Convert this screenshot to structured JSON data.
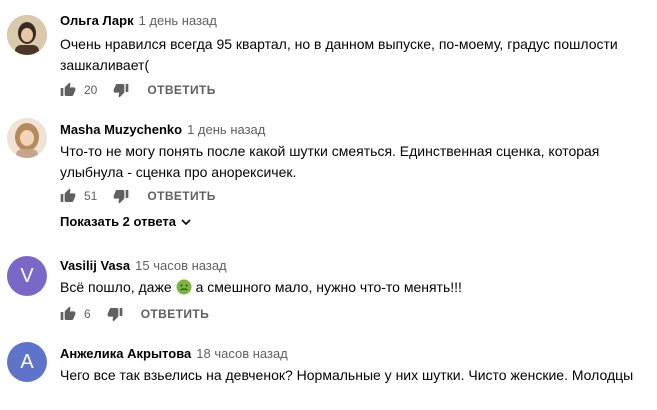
{
  "comments": [
    {
      "author": "Ольга Ларк",
      "time": "1 день назад",
      "text": "Очень нравился всегда 95 квартал, но в данном выпуске, по-моему, градус пошлости зашкаливает(",
      "likes": "20",
      "reply_label": "ОТВЕТИТЬ"
    },
    {
      "author": "Masha Muzychenko",
      "time": "1 день назад",
      "text": "Что-то не могу понять после какой шутки смеяться. Единственная сценка, которая улыбнула - сценка про анорексичек.",
      "likes": "51",
      "reply_label": "ОТВЕТИТЬ",
      "show_replies": "Показать 2 ответа"
    },
    {
      "author": "Vasilij Vasa",
      "time": "15 часов назад",
      "avatar_letter": "V",
      "text_before": "Всё пошло, даже",
      "text_after": "а смешного мало, нужно что-то менять!!!",
      "likes": "6",
      "reply_label": "ОТВЕТИТЬ"
    },
    {
      "author": "Анжелика Акрытова",
      "time": "18 часов назад",
      "avatar_letter": "А",
      "text": "Чего все так взьелись на девченок? Нормальные у них шутки. Чисто женские. Молодцы"
    }
  ],
  "colors": {
    "text": "#030303",
    "secondary": "#606060",
    "avatar_v": "#7a67c7",
    "avatar_a": "#5f74c9",
    "emoji": "#7cb342"
  },
  "icons": {
    "like": "thumbs-up-icon",
    "dislike": "thumbs-down-icon",
    "expand": "chevron-down-icon",
    "emoji": "nauseated-face-emoji"
  }
}
